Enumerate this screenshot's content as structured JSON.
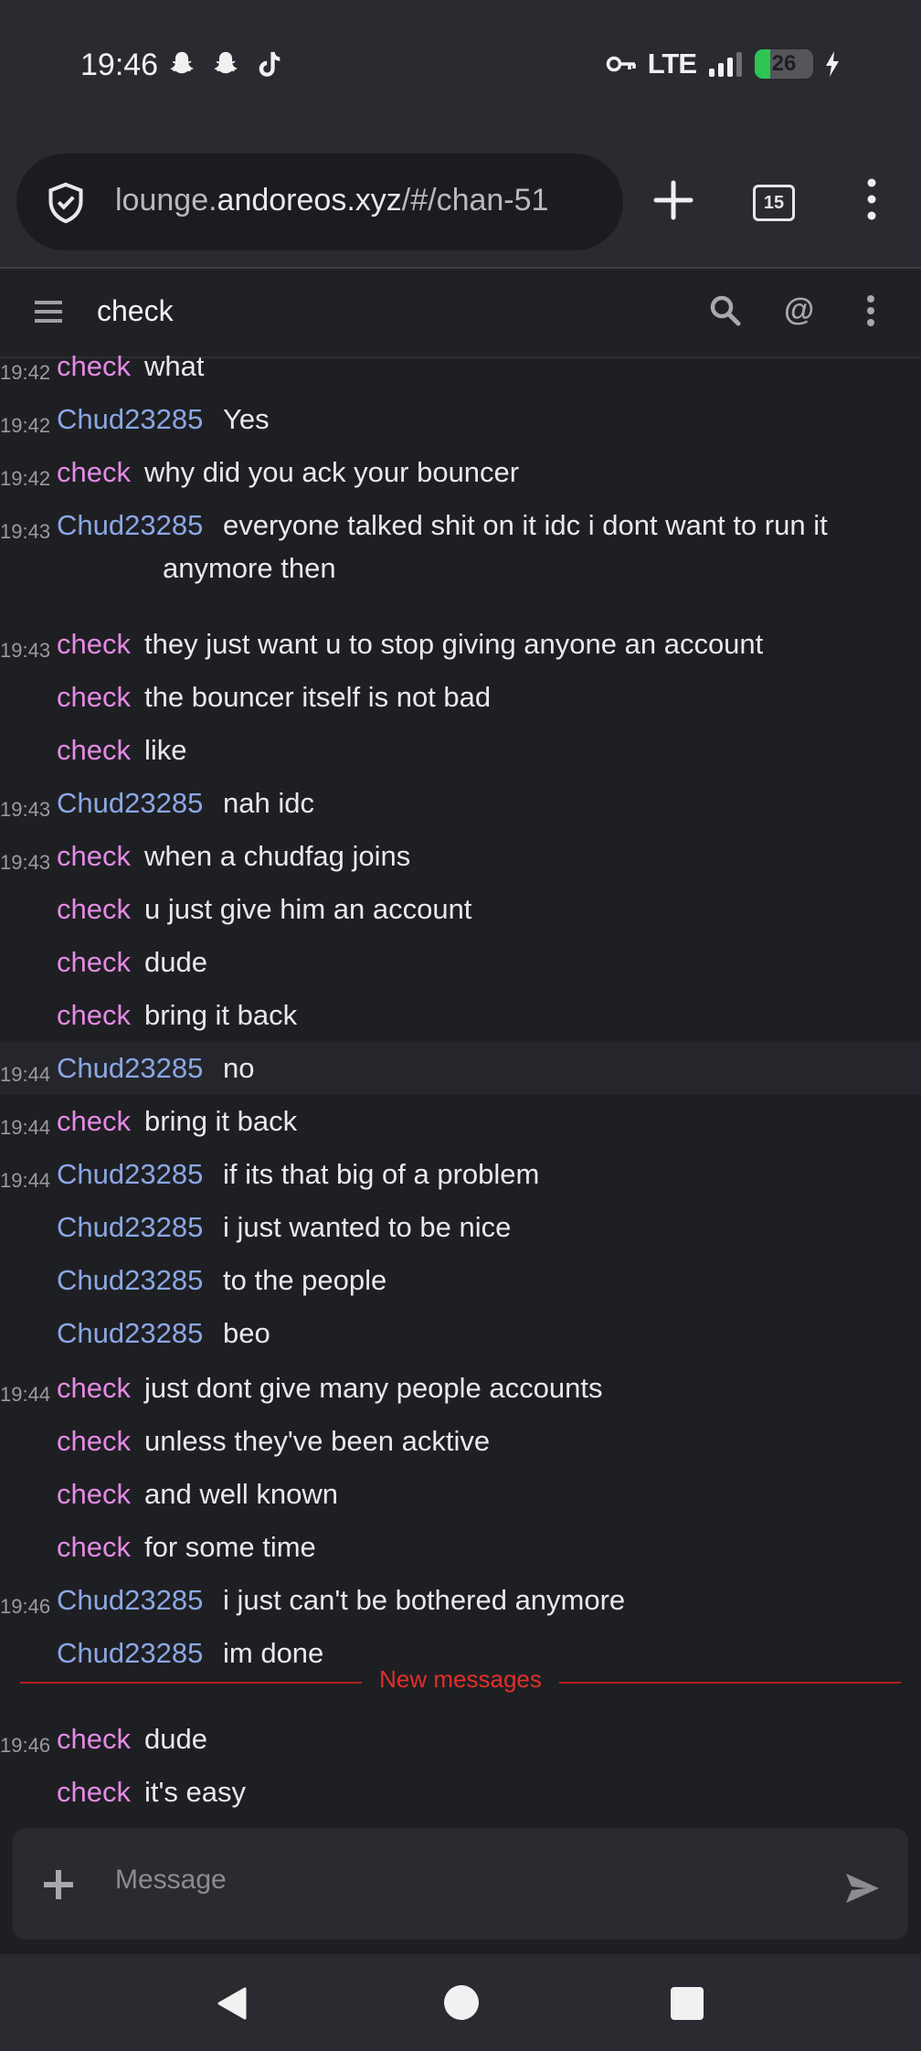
{
  "status_bar": {
    "time": "19:46",
    "network": "LTE",
    "battery_percent": "26",
    "battery_level": 0.26,
    "icons_left": [
      "snapchat-icon",
      "snapchat-icon",
      "tiktok-icon"
    ],
    "icons_right": [
      "vpn-key-icon",
      "signal-icon",
      "battery-icon",
      "charging-icon"
    ]
  },
  "browser": {
    "url_prefix": "lounge.",
    "url_domain": "andoreos.xyz",
    "url_path": "/#/chan-51",
    "tab_count": "15"
  },
  "channel": {
    "name": "check"
  },
  "messages": [
    {
      "time": "19:42",
      "nick": "check",
      "text": "what"
    },
    {
      "time": "19:42",
      "nick": "Chud23285",
      "text": "Yes"
    },
    {
      "time": "19:42",
      "nick": "check",
      "text": "why did you ack your bouncer"
    },
    {
      "time": "19:43",
      "nick": "Chud23285",
      "text": "everyone talked shit on it idc i dont want to run it",
      "cont": "anymore then"
    },
    {
      "time": "19:43",
      "nick": "check",
      "text": "they just want u to stop giving anyone an account"
    },
    {
      "time": "",
      "nick": "check",
      "text": "the bouncer itself is not bad"
    },
    {
      "time": "",
      "nick": "check",
      "text": "like"
    },
    {
      "time": "19:43",
      "nick": "Chud23285",
      "text": "nah idc"
    },
    {
      "time": "19:43",
      "nick": "check",
      "text": "when a chudfag joins"
    },
    {
      "time": "",
      "nick": "check",
      "text": "u just give him an account"
    },
    {
      "time": "",
      "nick": "check",
      "text": "dude"
    },
    {
      "time": "",
      "nick": "check",
      "text": "bring it back"
    },
    {
      "time": "19:44",
      "nick": "Chud23285",
      "text": "no"
    },
    {
      "time": "19:44",
      "nick": "check",
      "text": "bring it back"
    },
    {
      "time": "19:44",
      "nick": "Chud23285",
      "text": "if its that big of a problem"
    },
    {
      "time": "",
      "nick": "Chud23285",
      "text": "i just wanted to be nice"
    },
    {
      "time": "",
      "nick": "Chud23285",
      "text": "to the people"
    },
    {
      "time": "",
      "nick": "Chud23285",
      "text": "beo"
    },
    {
      "time": "19:44",
      "nick": "check",
      "text": "just dont give many people accounts"
    },
    {
      "time": "",
      "nick": "check",
      "text": "unless they've been acktive"
    },
    {
      "time": "",
      "nick": "check",
      "text": "and well known"
    },
    {
      "time": "",
      "nick": "check",
      "text": "for some time"
    },
    {
      "time": "19:46",
      "nick": "Chud23285",
      "text": "i just can't be bothered anymore"
    },
    {
      "time": "",
      "nick": "Chud23285",
      "text": "im done"
    },
    {
      "time": "19:46",
      "nick": "check",
      "text": "dude"
    },
    {
      "time": "",
      "nick": "check",
      "text": "it's easy"
    }
  ],
  "new_messages_label": "New messages",
  "composer": {
    "placeholder": "Message"
  },
  "colors": {
    "nick_check": "#e58ae6",
    "nick_chud": "#8ba7e6",
    "new_messages": "#e0302b"
  }
}
